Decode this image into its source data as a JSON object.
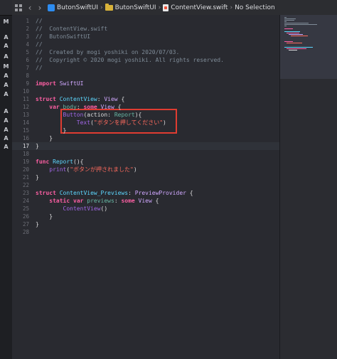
{
  "status_gutter": [
    "M",
    "A",
    "A",
    "A",
    "M",
    "A",
    "A",
    "A",
    "A",
    "A",
    "A",
    "A",
    "A",
    "A"
  ],
  "jumpbar": {
    "crumbs": [
      "ButonSwiftUI",
      "ButonSwiftUI",
      "ContentView.swift",
      "No Selection"
    ]
  },
  "editor": {
    "current_line": 17,
    "line_numbers": [
      "1",
      "2",
      "3",
      "4",
      "5",
      "6",
      "7",
      "8",
      "9",
      "10",
      "11",
      "12",
      "13",
      "14",
      "15",
      "16",
      "17",
      "18",
      "19",
      "20",
      "21",
      "22",
      "23",
      "24",
      "25",
      "26",
      "27",
      "28"
    ],
    "lines": [
      "//",
      "//  ContentView.swift",
      "//  ButonSwiftUI",
      "//",
      "//  Created by mogi yoshiki on 2020/07/03.",
      "//  Copyright © 2020 mogi yoshiki. All rights reserved.",
      "//",
      "",
      "import SwiftUI",
      "",
      "struct ContentView: View {",
      "    var body: some View {",
      "        Button(action: Report){",
      "            Text(\"ボタンを押してください\")",
      "        }",
      "    }",
      "}",
      "",
      "func Report(){",
      "    print(\"ボタンが押されました\")",
      "}",
      "",
      "struct ContentView_Previews: PreviewProvider {",
      "    static var previews: some View {",
      "        ContentView()",
      "    }",
      "}",
      ""
    ]
  },
  "colors": {
    "background": "#292a30",
    "comment": "#7f8c98",
    "keyword": "#fc5fa3",
    "type": "#5dd8ff",
    "string": "#fc6a5d",
    "highlight_box": "#e03c31"
  }
}
